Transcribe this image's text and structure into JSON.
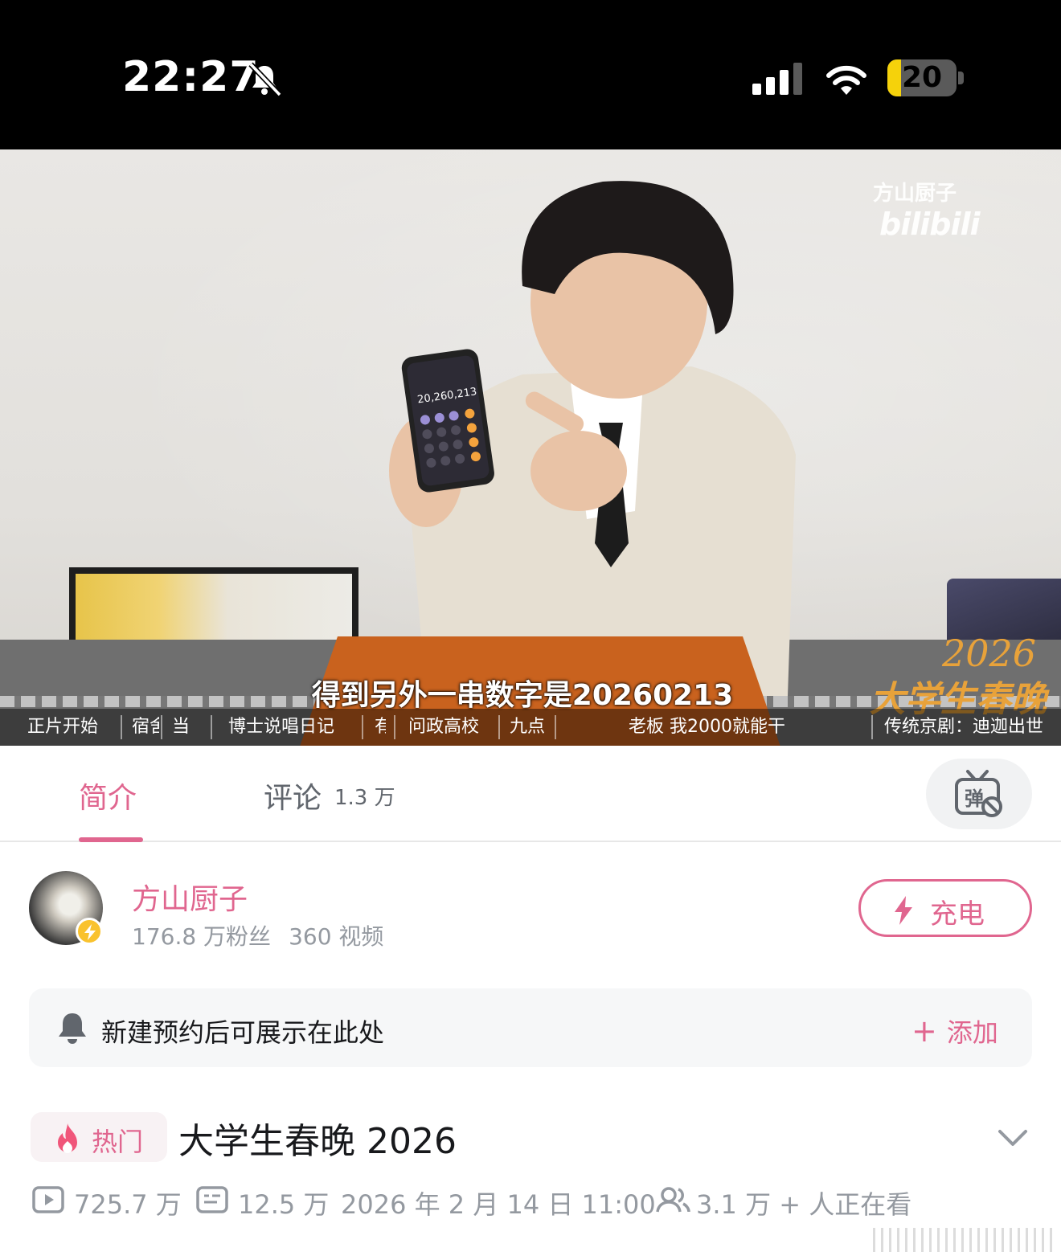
{
  "status_bar": {
    "time": "22:27",
    "battery_level": "20",
    "battery_fraction": 0.2,
    "icons": [
      "bell-slash-icon",
      "cellular-signal-icon",
      "wifi-icon",
      "battery-icon"
    ]
  },
  "video": {
    "watermark_channel": "方山厨子",
    "watermark_logo": "bilibili",
    "subtitle": "得到另外一串数字是20260213",
    "event_logo_year": "2026",
    "event_logo_name": "大学生春晚",
    "chapters": [
      "正片开始",
      "宿舍",
      "当",
      "博士说唱日记",
      "有",
      "问政高校",
      "九点",
      "老板 我2000就能干",
      "传统京剧：迪迦出世"
    ]
  },
  "tabs": {
    "intro": "简介",
    "comments": "评论",
    "comments_count": "1.3 万",
    "danmaku_icon": "danmaku-off-icon"
  },
  "uploader": {
    "name": "方山厨子",
    "fans": "176.8 万粉丝",
    "videos": "360 视频",
    "charge_label": "充电"
  },
  "reserve": {
    "text": "新建预约后可展示在此处",
    "add_label": "添加"
  },
  "video_info": {
    "hot_label": "热门",
    "title": "大学生春晚 2026",
    "views": "725.7 万",
    "danmaku_count": "12.5 万",
    "publish_time": "2026 年 2 月 14 日  11:00",
    "watching": "3.1 万 + 人正在看"
  },
  "colors": {
    "accent_pink": "#e0668f",
    "secondary_text": "#9499a0",
    "primary_text": "#18191c"
  }
}
